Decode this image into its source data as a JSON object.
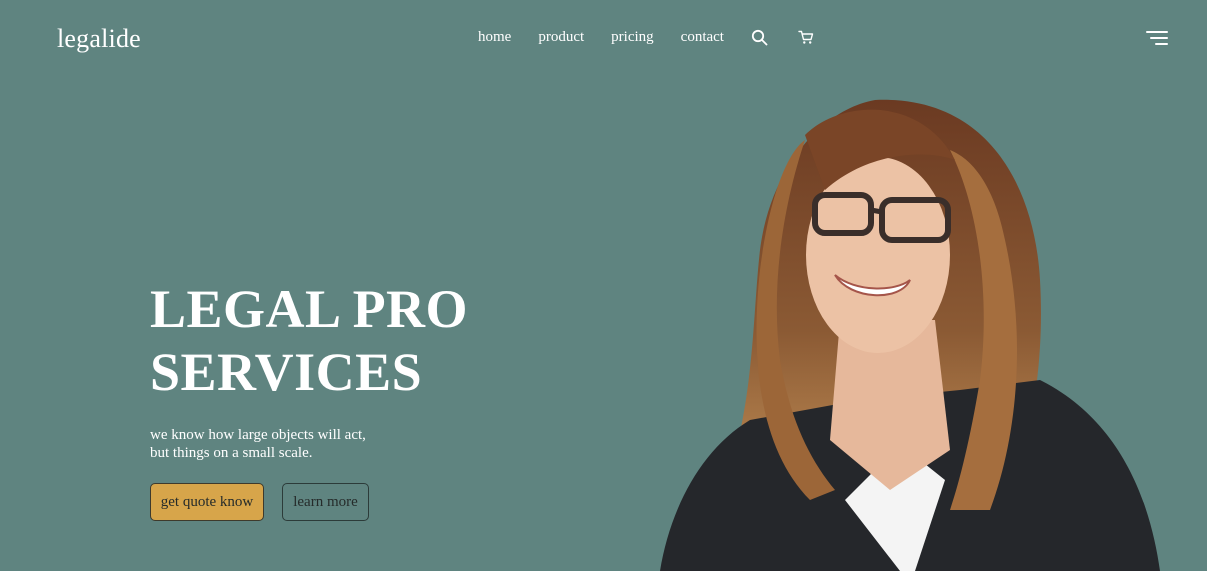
{
  "header": {
    "logo": "legalide",
    "nav": [
      {
        "label": "home"
      },
      {
        "label": "product"
      },
      {
        "label": "pricing"
      },
      {
        "label": "contact"
      }
    ],
    "icons": [
      "search-icon",
      "cart-icon",
      "hamburger-menu-icon"
    ]
  },
  "hero": {
    "title_line1": "LEGAL PRO",
    "title_line2": "SERVICES",
    "subtitle_line1": "we know how large objects will act,",
    "subtitle_line2": "but things on a small scale.",
    "primary_button": "get quote know",
    "secondary_button": "learn more"
  },
  "colors": {
    "background": "#5f8480",
    "primary_button": "#d7a54a",
    "text": "#ffffff"
  }
}
